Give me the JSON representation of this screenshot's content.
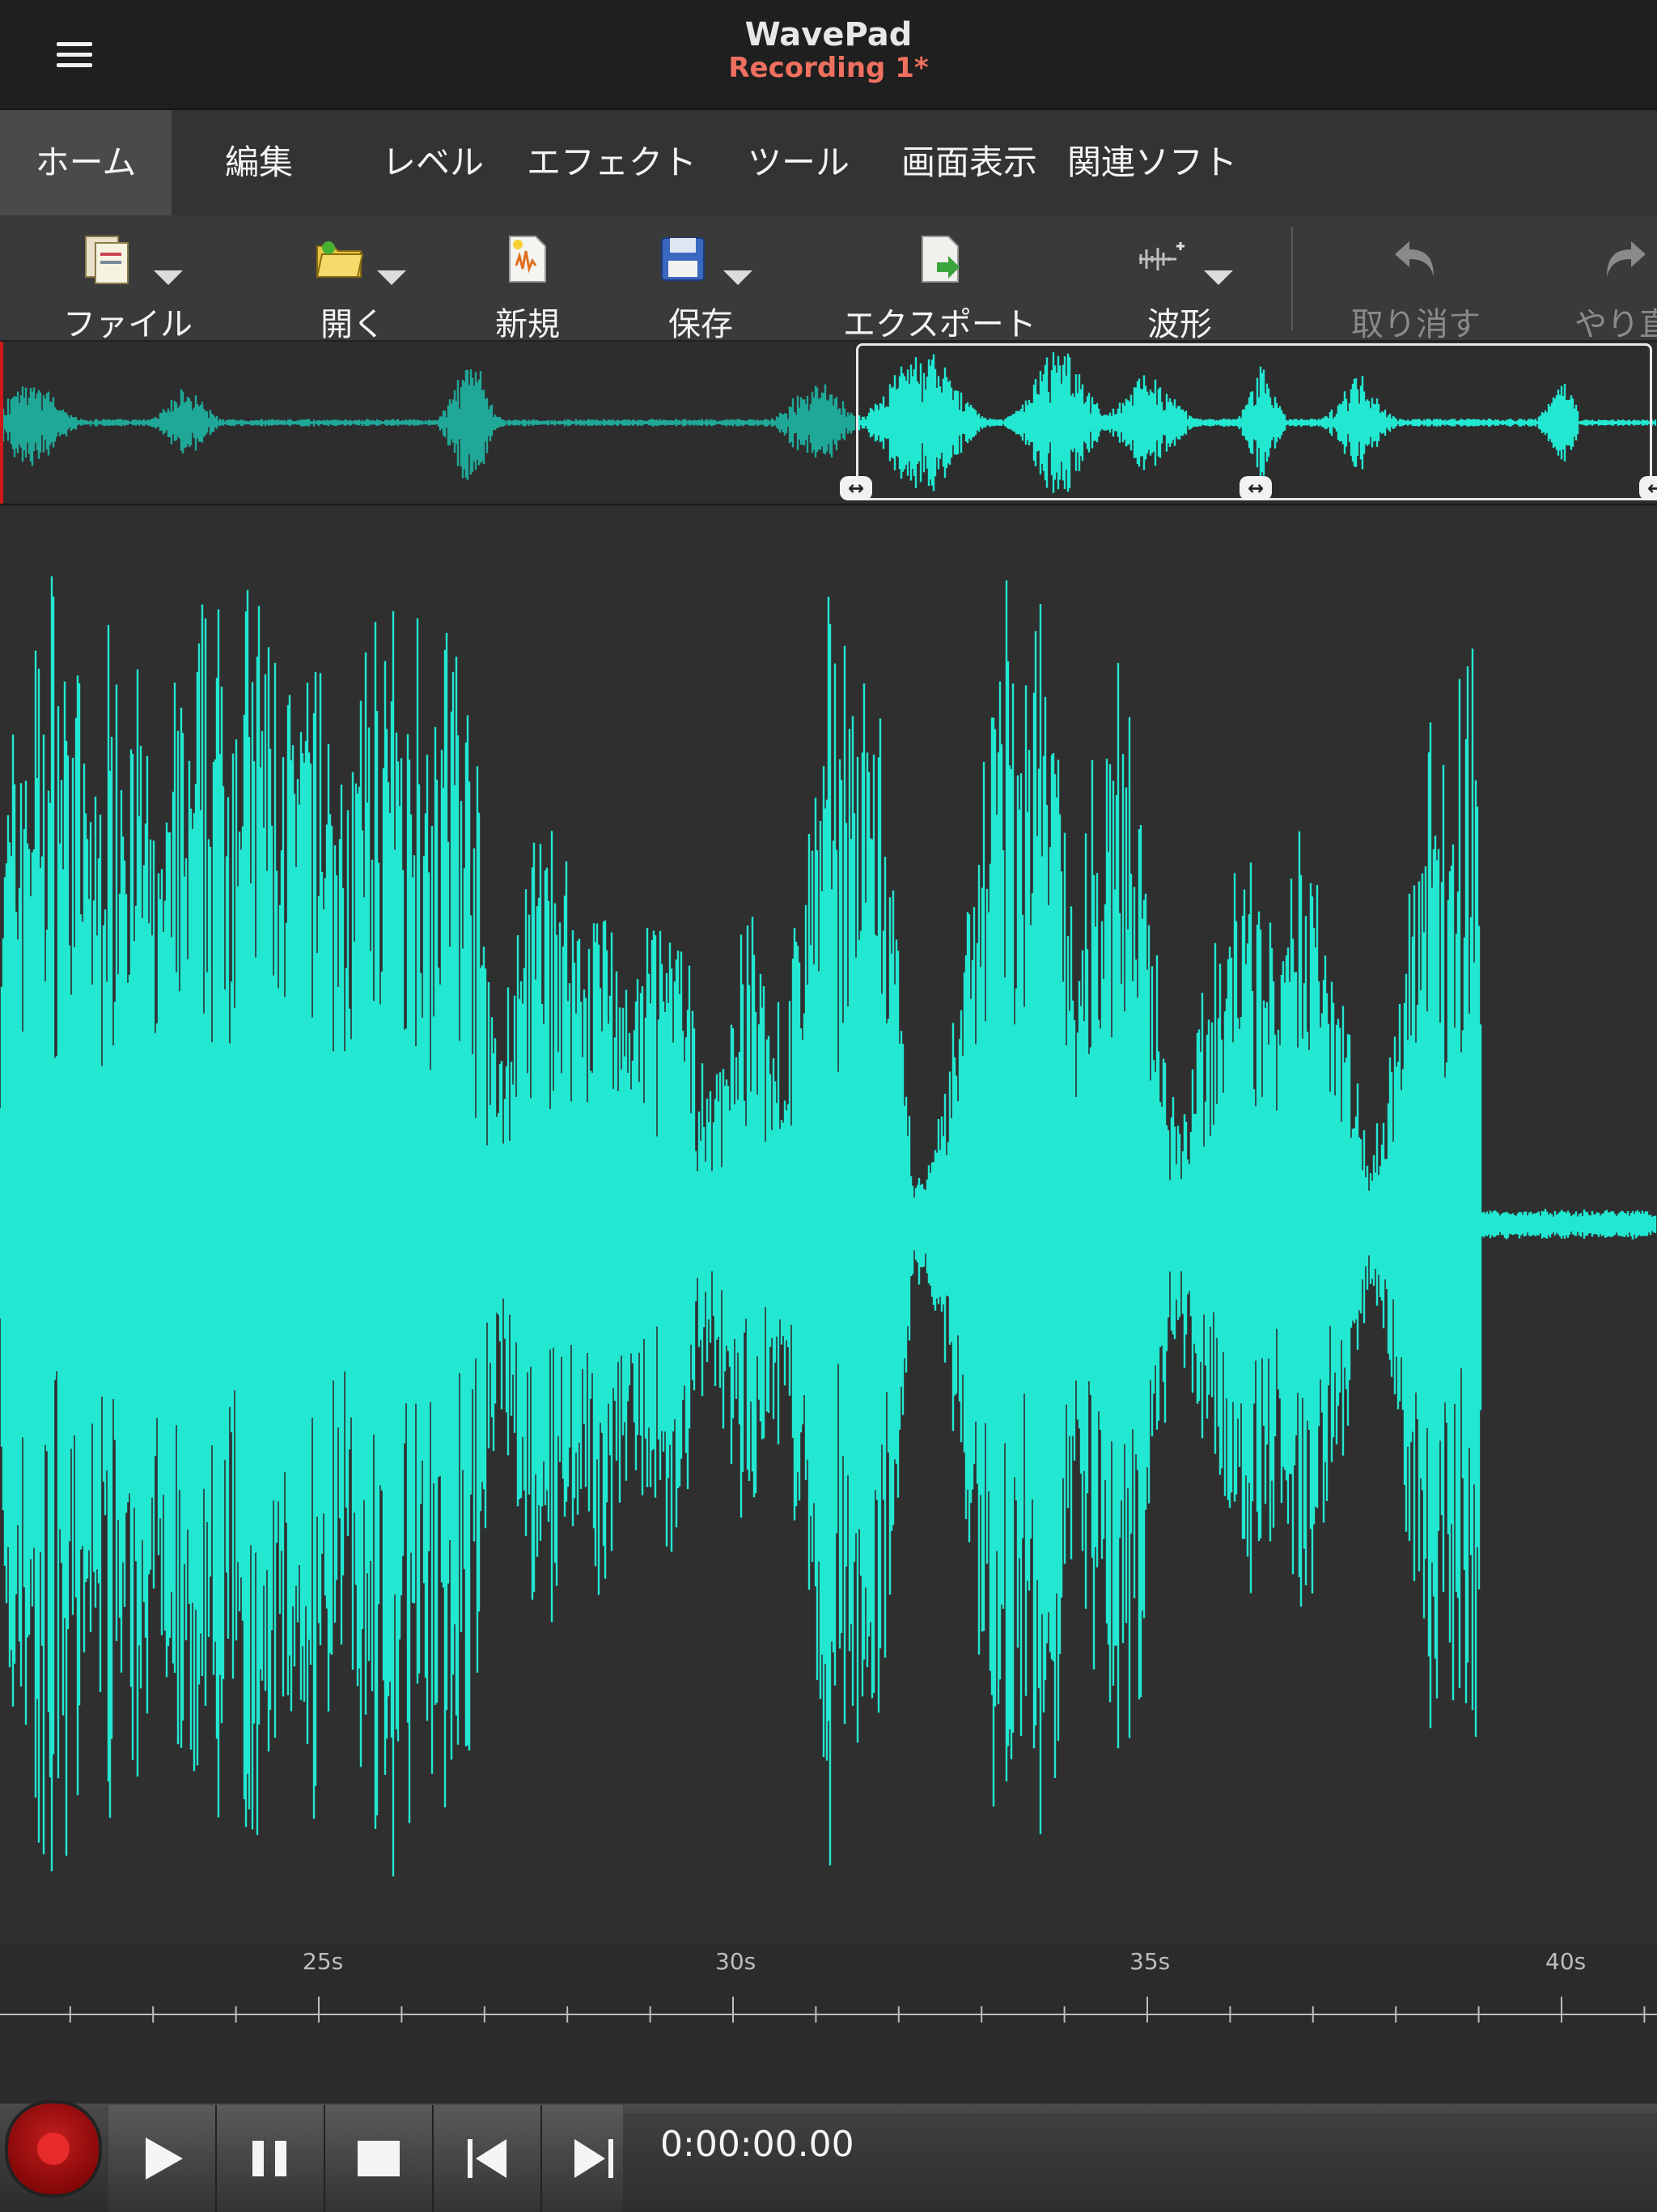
{
  "header": {
    "app_title": "WavePad",
    "doc_title": "Recording 1*"
  },
  "tabs": [
    {
      "label": "ホーム",
      "active": true
    },
    {
      "label": "編集"
    },
    {
      "label": "レベル"
    },
    {
      "label": "エフェクト"
    },
    {
      "label": "ツール"
    },
    {
      "label": "画面表示"
    },
    {
      "label": "関連ソフト"
    }
  ],
  "toolbar": {
    "file": "ファイル",
    "open": "開く",
    "new": "新規",
    "save": "保存",
    "export": "エクスポート",
    "waveform": "波形",
    "undo": "取り消す",
    "redo": "やり直"
  },
  "timeline": {
    "labels": [
      "25s",
      "30s",
      "35s",
      "40s"
    ]
  },
  "transport": {
    "time": "0:00:00.00"
  },
  "colors": {
    "waveform": "#22e8d2",
    "waveform_dim": "#1fa898",
    "accent_title": "#f07060",
    "playhead": "#d01818"
  }
}
